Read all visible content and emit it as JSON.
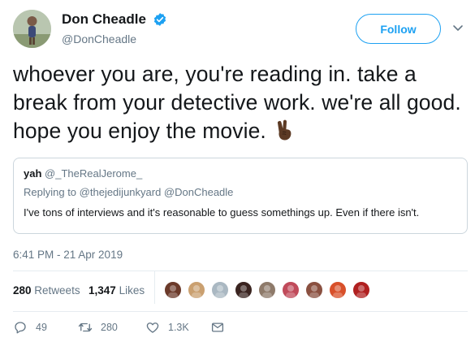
{
  "author": {
    "display_name": "Don Cheadle",
    "handle": "@DonCheadle",
    "verified_icon": "verified-badge-icon",
    "avatar": "profile-photo"
  },
  "follow_label": "Follow",
  "tweet_text": "whoever you are, you're reading in. take a break from your detective work. we're all good. hope you enjoy the movie.",
  "tweet_emoji": "victory-hand-emoji",
  "quoted": {
    "name": "yah",
    "handle": "@_TheRealJerome_",
    "reply_prefix": "Replying to",
    "reply_to": "@thejedijunkyard @DonCheadle",
    "text": "I've tons of interviews and it's reasonable to guess somethings up. Even if there isn't."
  },
  "timestamp": "6:41 PM - 21 Apr 2019",
  "stats": {
    "retweets_count": "280",
    "retweets_label": "Retweets",
    "likes_count": "1,347",
    "likes_label": "Likes"
  },
  "liker_avatars": [
    "#6b3a2a",
    "#caa070",
    "#aab8c2",
    "#3a2420",
    "#8e7a6a",
    "#c04a5a",
    "#8a5040",
    "#d8502a",
    "#b02020"
  ],
  "actions": {
    "reply_count": "49",
    "retweet_count": "280",
    "like_count": "1.3K"
  },
  "colors": {
    "accent": "#1da1f2",
    "text": "#14171a",
    "muted": "#657786",
    "border": "#ccd6dd"
  }
}
